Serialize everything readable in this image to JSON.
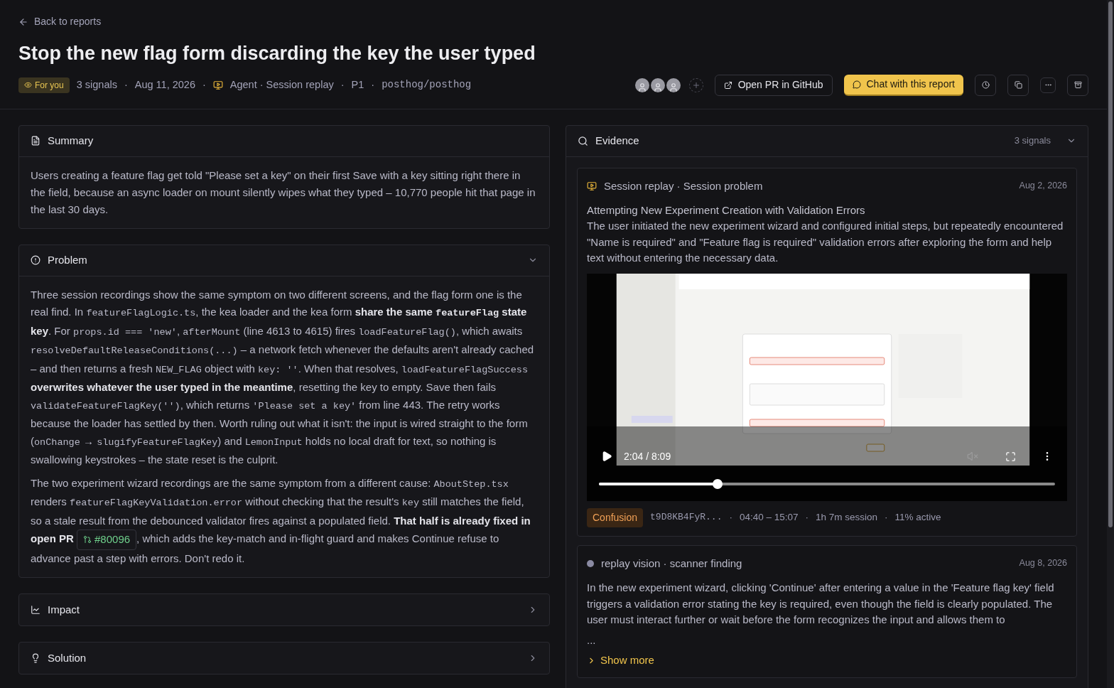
{
  "back_link": "Back to reports",
  "title": "Stop the new flag form discarding the key the user typed",
  "meta": {
    "badge": "For you",
    "separator": "·",
    "items": [
      {
        "kind": "text",
        "text": "3 signals"
      },
      {
        "kind": "text",
        "text": "Aug 11, 2026"
      },
      {
        "kind": "source",
        "text": "Agent · Session replay"
      },
      {
        "kind": "text",
        "text": "P1"
      },
      {
        "kind": "repo",
        "text": "posthog/posthog"
      }
    ]
  },
  "toolbar": {
    "open_pr": "Open PR in GitHub",
    "chat": "Chat with this report"
  },
  "summary": {
    "title": "Summary",
    "text": "Users creating a feature flag get told \"Please set a key\" on their first Save with a key sitting right there in the field, because an async loader on mount silently wipes what they typed – 10,770 people hit that page in the last 30 days."
  },
  "sections": [
    {
      "kind": "problem",
      "title": "Problem",
      "expanded": true,
      "paragraphs": [
        [
          {
            "kind": "text",
            "text": "Three session recordings show the same symptom on two different screens, and the flag form one is the real find. In "
          },
          {
            "kind": "code",
            "text": "featureFlagLogic.ts"
          },
          {
            "kind": "text",
            "text": ", the kea loader and the kea form "
          },
          {
            "kind": "bold",
            "text": "share the same "
          },
          {
            "kind": "bold_code",
            "text": "featureFlag"
          },
          {
            "kind": "bold",
            "text": " state key"
          },
          {
            "kind": "text",
            "text": ". For "
          },
          {
            "kind": "code",
            "text": "props.id === 'new'"
          },
          {
            "kind": "text",
            "text": ", "
          },
          {
            "kind": "code",
            "text": "afterMount"
          },
          {
            "kind": "text",
            "text": " (line 4613 to 4615) fires "
          },
          {
            "kind": "code",
            "text": "loadFeatureFlag()"
          },
          {
            "kind": "text",
            "text": ", which awaits "
          },
          {
            "kind": "code",
            "text": "resolveDefaultReleaseConditions(...)"
          },
          {
            "kind": "text",
            "text": " – a network fetch whenever the defaults aren't already cached – and then returns a fresh "
          },
          {
            "kind": "code",
            "text": "NEW_FLAG"
          },
          {
            "kind": "text",
            "text": " object with "
          },
          {
            "kind": "code",
            "text": "key: ''"
          },
          {
            "kind": "text",
            "text": ". When that resolves, "
          },
          {
            "kind": "code",
            "text": "loadFeatureFlagSuccess"
          },
          {
            "kind": "bold",
            "text": " overwrites whatever the user typed in the meantime"
          },
          {
            "kind": "text",
            "text": ", resetting the key to empty. Save then fails "
          },
          {
            "kind": "code",
            "text": "validateFeatureFlagKey('')"
          },
          {
            "kind": "text",
            "text": ", which returns "
          },
          {
            "kind": "code",
            "text": "'Please set a key'"
          },
          {
            "kind": "text",
            "text": " from line 443. The retry works because the loader has settled by then. Worth ruling out what it isn't: the input is wired straight to the form ("
          },
          {
            "kind": "code",
            "text": "onChange"
          },
          {
            "kind": "text",
            "text": " → "
          },
          {
            "kind": "code",
            "text": "slugifyFeatureFlagKey"
          },
          {
            "kind": "text",
            "text": ") and "
          },
          {
            "kind": "code",
            "text": "LemonInput"
          },
          {
            "kind": "text",
            "text": " holds no local draft for text, so nothing is swallowing keystrokes – the state reset is the culprit."
          }
        ],
        [
          {
            "kind": "text",
            "text": "The two experiment wizard recordings are the same symptom from a different cause: "
          },
          {
            "kind": "code",
            "text": "AboutStep.tsx"
          },
          {
            "kind": "text",
            "text": " renders "
          },
          {
            "kind": "code",
            "text": "featureFlagKeyValidation.error"
          },
          {
            "kind": "text",
            "text": " without checking that the result's "
          },
          {
            "kind": "code",
            "text": "key"
          },
          {
            "kind": "text",
            "text": " still matches the field, so a stale result from the debounced validator fires against a populated field. "
          },
          {
            "kind": "bold",
            "text": "That half is already fixed in open PR "
          },
          {
            "kind": "pr",
            "text": "#80096"
          },
          {
            "kind": "text",
            "text": ", which adds the key-match and in-flight guard and makes Continue refuse to advance past a step with errors. Don't redo it."
          }
        ]
      ]
    },
    {
      "kind": "impact",
      "title": "Impact",
      "expanded": false
    },
    {
      "kind": "solution",
      "title": "Solution",
      "expanded": false
    }
  ],
  "evidence": {
    "title": "Evidence",
    "count": "3 signals",
    "items": [
      {
        "kind": "session_replay",
        "source": "Session replay · Session problem",
        "date": "Aug 2, 2026",
        "heading": "Attempting New Experiment Creation with Validation Errors",
        "text": "The user initiated the new experiment wizard and configured initial steps, but repeatedly encountered \"Name is required\" and \"Feature flag is required\" validation errors after exploring the form and help text without entering the necessary data.",
        "video": {
          "time": "2:04 / 8:09",
          "level": 0.26
        },
        "tag": "Confusion",
        "details": [
          {
            "kind": "id",
            "text": "t9D8KB4FyR..."
          },
          {
            "kind": "text",
            "text": "04:40 – 15:07"
          },
          {
            "kind": "text",
            "text": "1h 7m session"
          },
          {
            "kind": "text",
            "text": "11% active"
          }
        ]
      },
      {
        "kind": "scanner_finding",
        "source": "replay vision · scanner finding",
        "color": "#8b8ba3",
        "date": "Aug 8, 2026",
        "text": "In the new experiment wizard, clicking 'Continue' after entering a value in the 'Feature flag key' field triggers a validation error stating the key is required, even though the field is clearly populated. The user must interact further or wait before the form recognizes the input and allows them to",
        "ellipsis": "...",
        "show_more": "Show more"
      }
    ]
  }
}
